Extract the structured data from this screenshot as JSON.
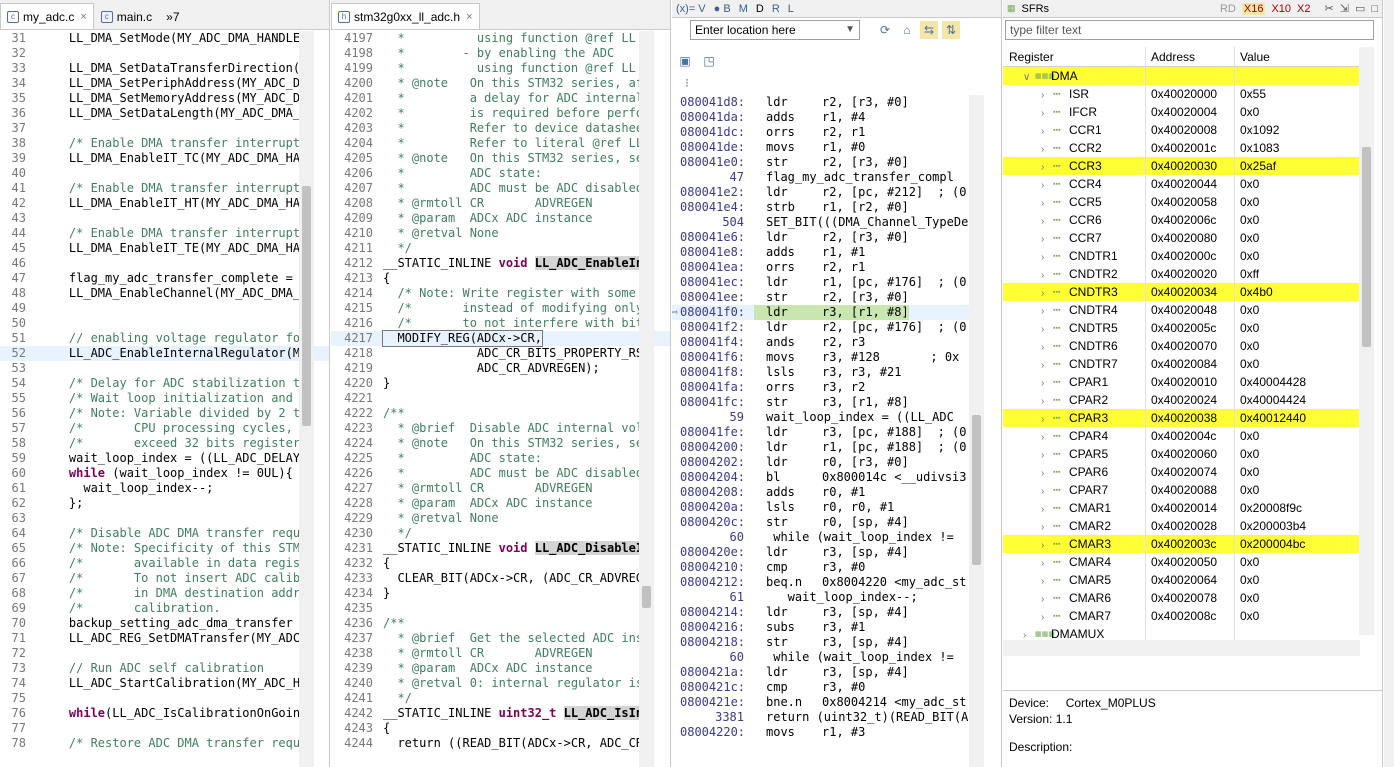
{
  "editor1": {
    "tabs": [
      {
        "label": "my_adc.c",
        "close": "×"
      },
      {
        "label": "main.c"
      },
      {
        "label": "»7"
      }
    ],
    "lines": [
      {
        "n": "31",
        "t": "    LL_DMA_SetMode(MY_ADC_DMA_HANDLER",
        "c": ""
      },
      {
        "n": "32",
        "t": "",
        "c": ""
      },
      {
        "n": "33",
        "t": "    LL_DMA_SetDataTransferDirection(M",
        "c": ""
      },
      {
        "n": "34",
        "t": "    LL_DMA_SetPeriphAddress(MY_ADC_DM",
        "c": ""
      },
      {
        "n": "35",
        "t": "    LL_DMA_SetMemoryAddress(MY_ADC_DM",
        "c": ""
      },
      {
        "n": "36",
        "t": "    LL_DMA_SetDataLength(MY_ADC_DMA_H",
        "c": ""
      },
      {
        "n": "37",
        "t": "",
        "c": ""
      },
      {
        "n": "38",
        "t": "    /* Enable DMA transfer interrupti",
        "c": "cm"
      },
      {
        "n": "39",
        "t": "    LL_DMA_EnableIT_TC(MY_ADC_DMA_HAN",
        "c": ""
      },
      {
        "n": "40",
        "t": "",
        "c": ""
      },
      {
        "n": "41",
        "t": "    /* Enable DMA transfer interrupti",
        "c": "cm"
      },
      {
        "n": "42",
        "t": "    LL_DMA_EnableIT_HT(MY_ADC_DMA_HAN",
        "c": ""
      },
      {
        "n": "43",
        "t": "",
        "c": ""
      },
      {
        "n": "44",
        "t": "    /* Enable DMA transfer interrupti",
        "c": "cm"
      },
      {
        "n": "45",
        "t": "    LL_DMA_EnableIT_TE(MY_ADC_DMA_HAN",
        "c": ""
      },
      {
        "n": "46",
        "t": "",
        "c": ""
      },
      {
        "n": "47",
        "t": "    flag_my_adc_transfer_complete = 0",
        "c": ""
      },
      {
        "n": "48",
        "t": "    LL_DMA_EnableChannel(MY_ADC_DMA_H",
        "c": ""
      },
      {
        "n": "49",
        "t": "",
        "c": ""
      },
      {
        "n": "50",
        "t": "",
        "c": ""
      },
      {
        "n": "51",
        "t": "    // enabling voltage regulator for",
        "c": "cm"
      },
      {
        "n": "52",
        "t": "    LL_ADC_EnableInternalRegulator(MY",
        "c": "hl"
      },
      {
        "n": "53",
        "t": "",
        "c": ""
      },
      {
        "n": "54",
        "t": "    /* Delay for ADC stabilization ti",
        "c": "cm"
      },
      {
        "n": "55",
        "t": "    /* Wait loop initialization and e",
        "c": "cm"
      },
      {
        "n": "56",
        "t": "    /* Note: Variable divided by 2 to",
        "c": "cm"
      },
      {
        "n": "57",
        "t": "    /*       CPU processing cycles, s",
        "c": "cm"
      },
      {
        "n": "58",
        "t": "    /*       exceed 32 bits register ",
        "c": "cm"
      },
      {
        "n": "59",
        "t": "    wait_loop_index = ((LL_ADC_DELAY_",
        "c": ""
      },
      {
        "n": "60",
        "t": "    while (wait_loop_index != 0UL){",
        "c": "kwline"
      },
      {
        "n": "61",
        "t": "      wait_loop_index--;",
        "c": ""
      },
      {
        "n": "62",
        "t": "    };",
        "c": ""
      },
      {
        "n": "63",
        "t": "",
        "c": ""
      },
      {
        "n": "64",
        "t": "    /* Disable ADC DMA transfer reque",
        "c": "cm"
      },
      {
        "n": "65",
        "t": "    /* Note: Specificity of this STM3",
        "c": "cm"
      },
      {
        "n": "66",
        "t": "    /*       available in data regist",
        "c": "cm"
      },
      {
        "n": "67",
        "t": "    /*       To not insert ADC calibr",
        "c": "cm"
      },
      {
        "n": "68",
        "t": "    /*       in DMA destination addre",
        "c": "cm"
      },
      {
        "n": "69",
        "t": "    /*       calibration.",
        "c": "cm"
      },
      {
        "n": "70",
        "t": "    backup_setting_adc_dma_transfer =",
        "c": ""
      },
      {
        "n": "71",
        "t": "    LL_ADC_REG_SetDMATransfer(MY_ADC_",
        "c": ""
      },
      {
        "n": "72",
        "t": "",
        "c": ""
      },
      {
        "n": "73",
        "t": "    // Run ADC self calibration",
        "c": "cm"
      },
      {
        "n": "74",
        "t": "    LL_ADC_StartCalibration(MY_ADC_HA",
        "c": ""
      },
      {
        "n": "75",
        "t": "",
        "c": ""
      },
      {
        "n": "76",
        "t": "    while(LL_ADC_IsCalibrationOnGoing",
        "c": "kwline2"
      },
      {
        "n": "77",
        "t": "",
        "c": ""
      },
      {
        "n": "78",
        "t": "    /* Restore ADC DMA transfer reque",
        "c": "cm"
      }
    ]
  },
  "editor2": {
    "tabs": [
      {
        "label": "stm32g0xx_ll_adc.h",
        "close": "×"
      }
    ],
    "lines": [
      {
        "n": "4197",
        "t": "  *          using function @ref LL",
        "c": "cm"
      },
      {
        "n": "4198",
        "t": "  *        - by enabling the ADC",
        "c": "cm"
      },
      {
        "n": "4199",
        "t": "  *          using function @ref LL",
        "c": "cm"
      },
      {
        "n": "4200",
        "t": "  * @note   On this STM32 series, af",
        "c": "cm"
      },
      {
        "n": "4201",
        "t": "  *         a delay for ADC internal",
        "c": "cm"
      },
      {
        "n": "4202",
        "t": "  *         is required before perfo",
        "c": "cm"
      },
      {
        "n": "4203",
        "t": "  *         Refer to device datashee",
        "c": "cm"
      },
      {
        "n": "4204",
        "t": "  *         Refer to literal @ref LL",
        "c": "cm"
      },
      {
        "n": "4205",
        "t": "  * @note   On this STM32 series, se",
        "c": "cm"
      },
      {
        "n": "4206",
        "t": "  *         ADC state:",
        "c": "cm"
      },
      {
        "n": "4207",
        "t": "  *         ADC must be ADC disabled",
        "c": "cm"
      },
      {
        "n": "4208",
        "t": "  * @rmtoll CR       ADVREGEN",
        "c": "cm"
      },
      {
        "n": "4209",
        "t": "  * @param  ADCx ADC instance",
        "c": "cm"
      },
      {
        "n": "4210",
        "t": "  * @retval None",
        "c": "cm"
      },
      {
        "n": "4211",
        "t": "  */",
        "c": "cm"
      },
      {
        "n": "4212",
        "t": "__STATIC_INLINE void LL_ADC_EnableIn",
        "c": "decl"
      },
      {
        "n": "4213",
        "t": "{",
        "c": ""
      },
      {
        "n": "4214",
        "t": "  /* Note: Write register with some",
        "c": "cm"
      },
      {
        "n": "4215",
        "t": "  /*       instead of modifying only",
        "c": "cm"
      },
      {
        "n": "4216",
        "t": "  /*       to not interfere with bit",
        "c": "cm"
      },
      {
        "n": "4217",
        "t": "  MODIFY_REG(ADCx->CR,",
        "c": "cur"
      },
      {
        "n": "4218",
        "t": "             ADC_CR_BITS_PROPERTY_RS",
        "c": ""
      },
      {
        "n": "4219",
        "t": "             ADC_CR_ADVREGEN);",
        "c": ""
      },
      {
        "n": "4220",
        "t": "}",
        "c": ""
      },
      {
        "n": "4221",
        "t": "",
        "c": ""
      },
      {
        "n": "4222",
        "t": "/**",
        "c": "cm"
      },
      {
        "n": "4223",
        "t": "  * @brief  Disable ADC internal vol",
        "c": "cm"
      },
      {
        "n": "4224",
        "t": "  * @note   On this STM32 series, se",
        "c": "cm"
      },
      {
        "n": "4225",
        "t": "  *         ADC state:",
        "c": "cm"
      },
      {
        "n": "4226",
        "t": "  *         ADC must be ADC disabled",
        "c": "cm"
      },
      {
        "n": "4227",
        "t": "  * @rmtoll CR       ADVREGEN",
        "c": "cm"
      },
      {
        "n": "4228",
        "t": "  * @param  ADCx ADC instance",
        "c": "cm"
      },
      {
        "n": "4229",
        "t": "  * @retval None",
        "c": "cm"
      },
      {
        "n": "4230",
        "t": "  */",
        "c": "cm"
      },
      {
        "n": "4231",
        "t": "__STATIC_INLINE void LL_ADC_DisableI",
        "c": "decl2"
      },
      {
        "n": "4232",
        "t": "{",
        "c": ""
      },
      {
        "n": "4233",
        "t": "  CLEAR_BIT(ADCx->CR, (ADC_CR_ADVREG",
        "c": ""
      },
      {
        "n": "4234",
        "t": "}",
        "c": ""
      },
      {
        "n": "4235",
        "t": "",
        "c": ""
      },
      {
        "n": "4236",
        "t": "/**",
        "c": "cm"
      },
      {
        "n": "4237",
        "t": "  * @brief  Get the selected ADC ins",
        "c": "cm"
      },
      {
        "n": "4238",
        "t": "  * @rmtoll CR       ADVREGEN",
        "c": "cm"
      },
      {
        "n": "4239",
        "t": "  * @param  ADCx ADC instance",
        "c": "cm"
      },
      {
        "n": "4240",
        "t": "  * @retval 0: internal regulator is",
        "c": "cm"
      },
      {
        "n": "4241",
        "t": "  */",
        "c": "cm"
      },
      {
        "n": "4242",
        "t": "__STATIC_INLINE uint32_t LL_ADC_IsIn",
        "c": "decl3"
      },
      {
        "n": "4243",
        "t": "{",
        "c": ""
      },
      {
        "n": "4244",
        "t": "  return ((READ_BIT(ADCx->CR, ADC_CR",
        "c": ""
      }
    ]
  },
  "disasm": {
    "toolbar": [
      "(x)= V",
      "● B",
      "M",
      "D",
      "R",
      "L"
    ],
    "location": "Enter location here",
    "lines": [
      {
        "k": "a",
        "a": "080041d8:",
        "m": "ldr",
        "o": "r2, [r3, #0]"
      },
      {
        "k": "a",
        "a": "080041da:",
        "m": "adds",
        "o": "r1, #4"
      },
      {
        "k": "a",
        "a": "080041dc:",
        "m": "orrs",
        "o": "r2, r1"
      },
      {
        "k": "a",
        "a": "080041de:",
        "m": "movs",
        "o": "r1, #0"
      },
      {
        "k": "a",
        "a": "080041e0:",
        "m": "str",
        "o": "r2, [r3, #0]"
      },
      {
        "k": "s",
        "a": "47",
        "o": "flag_my_adc_transfer_compl"
      },
      {
        "k": "a",
        "a": "080041e2:",
        "m": "ldr",
        "o": "r2, [pc, #212]  ; (0"
      },
      {
        "k": "a",
        "a": "080041e4:",
        "m": "strb",
        "o": "r1, [r2, #0]"
      },
      {
        "k": "s",
        "a": "504",
        "o": "SET_BIT(((DMA_Channel_TypeDe"
      },
      {
        "k": "a",
        "a": "080041e6:",
        "m": "ldr",
        "o": "r2, [r3, #0]"
      },
      {
        "k": "a",
        "a": "080041e8:",
        "m": "adds",
        "o": "r1, #1"
      },
      {
        "k": "a",
        "a": "080041ea:",
        "m": "orrs",
        "o": "r2, r1"
      },
      {
        "k": "a",
        "a": "080041ec:",
        "m": "ldr",
        "o": "r1, [pc, #176]  ; (0"
      },
      {
        "k": "a",
        "a": "080041ee:",
        "m": "str",
        "o": "r2, [r3, #0]"
      },
      {
        "k": "cur",
        "a": "080041f0:",
        "m": "ldr",
        "o": "r3, [r1, #8]"
      },
      {
        "k": "a",
        "a": "080041f2:",
        "m": "ldr",
        "o": "r2, [pc, #176]  ; (0"
      },
      {
        "k": "a",
        "a": "080041f4:",
        "m": "ands",
        "o": "r2, r3"
      },
      {
        "k": "a",
        "a": "080041f6:",
        "m": "movs",
        "o": "r3, #128       ; 0x"
      },
      {
        "k": "a",
        "a": "080041f8:",
        "m": "lsls",
        "o": "r3, r3, #21"
      },
      {
        "k": "a",
        "a": "080041fa:",
        "m": "orrs",
        "o": "r3, r2"
      },
      {
        "k": "a",
        "a": "080041fc:",
        "m": "str",
        "o": "r3, [r1, #8]"
      },
      {
        "k": "s",
        "a": "59",
        "o": "wait_loop_index = ((LL_ADC"
      },
      {
        "k": "a",
        "a": "080041fe:",
        "m": "ldr",
        "o": "r3, [pc, #188]  ; (0"
      },
      {
        "k": "a",
        "a": "08004200:",
        "m": "ldr",
        "o": "r1, [pc, #188]  ; (0"
      },
      {
        "k": "a",
        "a": "08004202:",
        "m": "ldr",
        "o": "r0, [r3, #0]"
      },
      {
        "k": "a",
        "a": "08004204:",
        "m": "bl",
        "o": "0x800014c <__udivsi3"
      },
      {
        "k": "a",
        "a": "08004208:",
        "m": "adds",
        "o": "r0, #1"
      },
      {
        "k": "a",
        "a": "0800420a:",
        "m": "lsls",
        "o": "r0, r0, #1"
      },
      {
        "k": "a",
        "a": "0800420c:",
        "m": "str",
        "o": "r0, [sp, #4]"
      },
      {
        "k": "s",
        "a": "60",
        "o": " while (wait_loop_index !="
      },
      {
        "k": "a",
        "a": "0800420e:",
        "m": "ldr",
        "o": "r3, [sp, #4]"
      },
      {
        "k": "a",
        "a": "08004210:",
        "m": "cmp",
        "o": "r3, #0"
      },
      {
        "k": "a",
        "a": "08004212:",
        "m": "beq.n",
        "o": "0x8004220 <my_adc_st"
      },
      {
        "k": "s",
        "a": "61",
        "o": "   wait_loop_index--;"
      },
      {
        "k": "a",
        "a": "08004214:",
        "m": "ldr",
        "o": "r3, [sp, #4]"
      },
      {
        "k": "a",
        "a": "08004216:",
        "m": "subs",
        "o": "r3, #1"
      },
      {
        "k": "a",
        "a": "08004218:",
        "m": "str",
        "o": "r3, [sp, #4]"
      },
      {
        "k": "s",
        "a": "60",
        "o": " while (wait_loop_index !="
      },
      {
        "k": "a",
        "a": "0800421a:",
        "m": "ldr",
        "o": "r3, [sp, #4]"
      },
      {
        "k": "a",
        "a": "0800421c:",
        "m": "cmp",
        "o": "r3, #0"
      },
      {
        "k": "a",
        "a": "0800421e:",
        "m": "bne.n",
        "o": "0x8004214 <my_adc_st"
      },
      {
        "k": "s",
        "a": "3381",
        "o": "return (uint32_t)(READ_BIT(A"
      },
      {
        "k": "a",
        "a": "08004220:",
        "m": "movs",
        "o": "r1, #3"
      }
    ]
  },
  "sfr": {
    "title": "SFRs",
    "tool_labels": [
      "RD",
      "X16",
      "X10",
      "X2"
    ],
    "filter_placeholder": "type filter text",
    "headers": [
      "Register",
      "Address",
      "Value"
    ],
    "group": "DMA",
    "rows": [
      {
        "name": "ISR",
        "addr": "0x40020000",
        "val": "0x55",
        "hl": false
      },
      {
        "name": "IFCR",
        "addr": "0x40020004",
        "val": "0x0",
        "hl": false
      },
      {
        "name": "CCR1",
        "addr": "0x40020008",
        "val": "0x1092",
        "hl": false
      },
      {
        "name": "CCR2",
        "addr": "0x4002001c",
        "val": "0x1083",
        "hl": false
      },
      {
        "name": "CCR3",
        "addr": "0x40020030",
        "val": "0x25af",
        "hl": true
      },
      {
        "name": "CCR4",
        "addr": "0x40020044",
        "val": "0x0",
        "hl": false
      },
      {
        "name": "CCR5",
        "addr": "0x40020058",
        "val": "0x0",
        "hl": false
      },
      {
        "name": "CCR6",
        "addr": "0x4002006c",
        "val": "0x0",
        "hl": false
      },
      {
        "name": "CCR7",
        "addr": "0x40020080",
        "val": "0x0",
        "hl": false
      },
      {
        "name": "CNDTR1",
        "addr": "0x4002000c",
        "val": "0x0",
        "hl": false
      },
      {
        "name": "CNDTR2",
        "addr": "0x40020020",
        "val": "0xff",
        "hl": false
      },
      {
        "name": "CNDTR3",
        "addr": "0x40020034",
        "val": "0x4b0",
        "hl": true
      },
      {
        "name": "CNDTR4",
        "addr": "0x40020048",
        "val": "0x0",
        "hl": false
      },
      {
        "name": "CNDTR5",
        "addr": "0x4002005c",
        "val": "0x0",
        "hl": false
      },
      {
        "name": "CNDTR6",
        "addr": "0x40020070",
        "val": "0x0",
        "hl": false
      },
      {
        "name": "CNDTR7",
        "addr": "0x40020084",
        "val": "0x0",
        "hl": false
      },
      {
        "name": "CPAR1",
        "addr": "0x40020010",
        "val": "0x40004428",
        "hl": false
      },
      {
        "name": "CPAR2",
        "addr": "0x40020024",
        "val": "0x40004424",
        "hl": false
      },
      {
        "name": "CPAR3",
        "addr": "0x40020038",
        "val": "0x40012440",
        "hl": true
      },
      {
        "name": "CPAR4",
        "addr": "0x4002004c",
        "val": "0x0",
        "hl": false
      },
      {
        "name": "CPAR5",
        "addr": "0x40020060",
        "val": "0x0",
        "hl": false
      },
      {
        "name": "CPAR6",
        "addr": "0x40020074",
        "val": "0x0",
        "hl": false
      },
      {
        "name": "CPAR7",
        "addr": "0x40020088",
        "val": "0x0",
        "hl": false
      },
      {
        "name": "CMAR1",
        "addr": "0x40020014",
        "val": "0x20008f9c",
        "hl": false
      },
      {
        "name": "CMAR2",
        "addr": "0x40020028",
        "val": "0x200003b4",
        "hl": false
      },
      {
        "name": "CMAR3",
        "addr": "0x4002003c",
        "val": "0x200004bc",
        "hl": true
      },
      {
        "name": "CMAR4",
        "addr": "0x40020050",
        "val": "0x0",
        "hl": false
      },
      {
        "name": "CMAR5",
        "addr": "0x40020064",
        "val": "0x0",
        "hl": false
      },
      {
        "name": "CMAR6",
        "addr": "0x40020078",
        "val": "0x0",
        "hl": false
      },
      {
        "name": "CMAR7",
        "addr": "0x4002008c",
        "val": "0x0",
        "hl": false
      }
    ],
    "next_group": "DMAMUX",
    "device_label": "Device:",
    "device_value": "Cortex_M0PLUS",
    "version_label": "Version: 1.1",
    "description_label": "Description:",
    "highlight_color": "#ffff33"
  }
}
